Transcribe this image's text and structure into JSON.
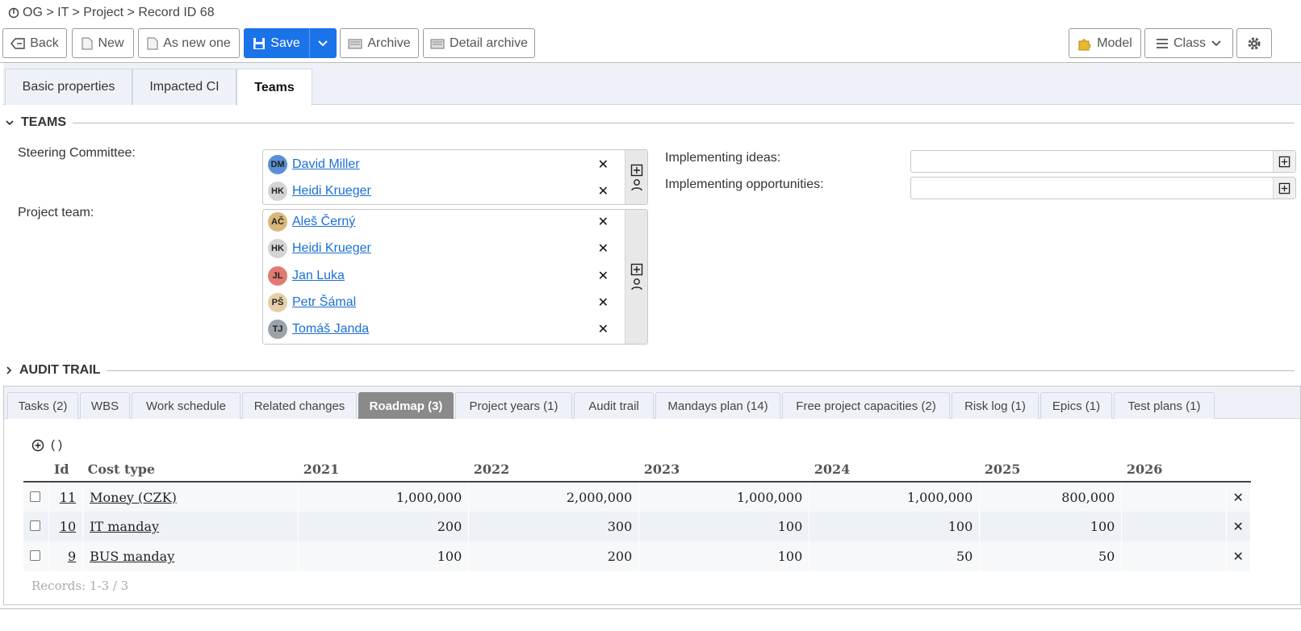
{
  "breadcrumb": {
    "path": "OG > IT > Project > Record ID 68"
  },
  "toolbar": {
    "back": "Back",
    "new": "New",
    "as_new_one": "As new one",
    "save": "Save",
    "archive": "Archive",
    "detail_archive": "Detail archive",
    "model": "Model",
    "class": "Class"
  },
  "form_tabs": [
    {
      "label": "Basic properties"
    },
    {
      "label": "Impacted CI"
    },
    {
      "label": "Teams"
    }
  ],
  "teams_section": {
    "title": "TEAMS",
    "steering_label": "Steering Committee:",
    "steering": [
      {
        "initials": "DM",
        "name": "David Miller",
        "color": "#5b8fd6"
      },
      {
        "initials": "HK",
        "name": "Heidi Krueger",
        "color": "#d4d4d4"
      }
    ],
    "project_team_label": "Project team:",
    "project_team": [
      {
        "initials": "AČ",
        "name": "Aleš Černý",
        "color": "#d9b77a"
      },
      {
        "initials": "HK",
        "name": "Heidi Krueger",
        "color": "#d4d4d4"
      },
      {
        "initials": "JL",
        "name": "Jan Luka",
        "color": "#e07a72"
      },
      {
        "initials": "PŠ",
        "name": "Petr Šámal",
        "color": "#e6cfa8"
      },
      {
        "initials": "TJ",
        "name": "Tomáš Janda",
        "color": "#9aa3aa"
      }
    ],
    "ideas_label": "Implementing ideas:",
    "opps_label": "Implementing opportunities:"
  },
  "audit_section": {
    "title": "AUDIT TRAIL"
  },
  "panel_tabs": [
    {
      "label": "Tasks (2)"
    },
    {
      "label": "WBS"
    },
    {
      "label": "Work schedule"
    },
    {
      "label": "Related changes"
    },
    {
      "label": "Roadmap (3)"
    },
    {
      "label": "Project years (1)"
    },
    {
      "label": "Audit trail"
    },
    {
      "label": "Mandays plan (14)"
    },
    {
      "label": "Free project capacities (2)"
    },
    {
      "label": "Risk log (1)"
    },
    {
      "label": "Epics (1)"
    },
    {
      "label": "Test plans (1)"
    }
  ],
  "grid": {
    "add_label": "( )",
    "headers": [
      "Id",
      "Cost type",
      "2021",
      "2022",
      "2023",
      "2024",
      "2025",
      "2026"
    ],
    "rows": [
      {
        "id": "11",
        "cost_type": "Money (CZK)",
        "y2021": "1,000,000",
        "y2022": "2,000,000",
        "y2023": "1,000,000",
        "y2024": "1,000,000",
        "y2025": "800,000",
        "y2026": ""
      },
      {
        "id": "10",
        "cost_type": "IT manday",
        "y2021": "200",
        "y2022": "300",
        "y2023": "100",
        "y2024": "100",
        "y2025": "100",
        "y2026": ""
      },
      {
        "id": "9",
        "cost_type": "BUS manday",
        "y2021": "100",
        "y2022": "200",
        "y2023": "100",
        "y2024": "50",
        "y2025": "50",
        "y2026": ""
      }
    ],
    "records": "Records: 1-3 / 3"
  }
}
